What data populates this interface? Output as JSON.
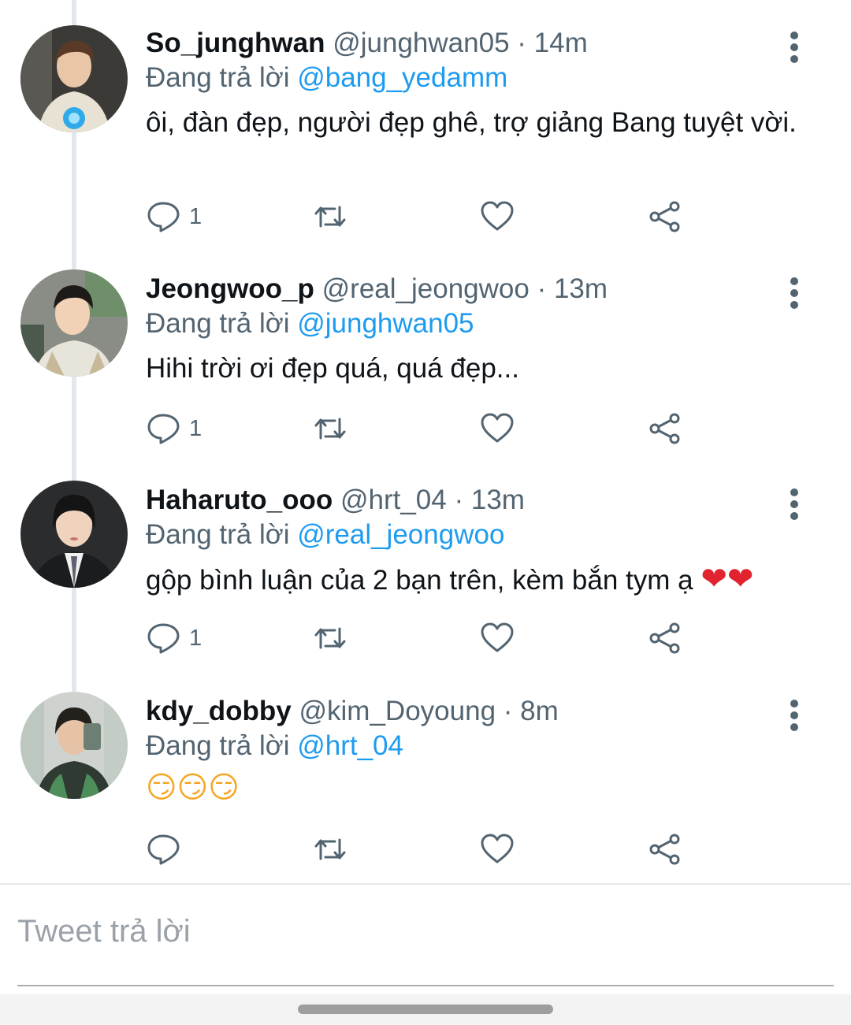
{
  "reply_prefix": "Đang trả lời",
  "tweets": [
    {
      "name": "So_junghwan",
      "handle": "@junghwan05",
      "sep": "·",
      "time": "14m",
      "reply_to": "@bang_yedamm",
      "text": "ôi, đàn đẹp, người đẹp ghê, trợ giảng Bang tuyệt vời.",
      "reply_count": "1"
    },
    {
      "name": "Jeongwoo_p",
      "handle": "@real_jeongwoo",
      "sep": "·",
      "time": "13m",
      "reply_to": "@junghwan05",
      "text": "Hihi trời ơi đẹp quá, quá đẹp...",
      "reply_count": "1"
    },
    {
      "name": "Haharuto_ooo",
      "handle": "@hrt_04",
      "sep": "·",
      "time": "13m",
      "reply_to": "@real_jeongwoo",
      "text": "gộp bình luận của 2 bạn trên, kèm bắn tym ạ",
      "emoji": "❤❤",
      "reply_count": "1"
    },
    {
      "name": "kdy_dobby",
      "handle": "@kim_Doyoung",
      "sep": "·",
      "time": "8m",
      "reply_to": "@hrt_04",
      "text": "",
      "emoji": "😏😏😏",
      "reply_count": ""
    }
  ],
  "reply_box": {
    "placeholder": "Tweet trả lời"
  },
  "colors": {
    "link": "#1d9bf0",
    "secondary": "#536471",
    "thread_line": "#e1e8ed"
  },
  "icons": [
    "reply-icon",
    "retweet-icon",
    "like-icon",
    "share-icon",
    "more-vertical-icon"
  ]
}
